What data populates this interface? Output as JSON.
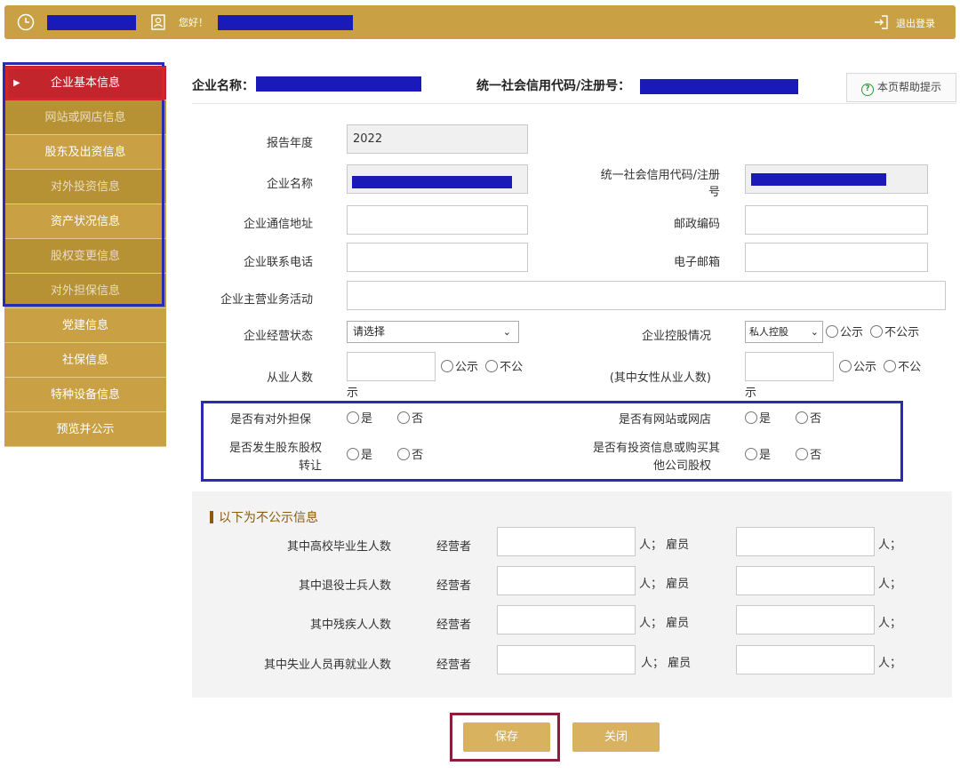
{
  "topbar": {
    "greeting": "您好！",
    "logout": "退出登录"
  },
  "sidebar": {
    "items": [
      {
        "label": "企业基本信息"
      },
      {
        "label": "网站或网店信息"
      },
      {
        "label": "股东及出资信息"
      },
      {
        "label": "对外投资信息"
      },
      {
        "label": "资产状况信息"
      },
      {
        "label": "股权变更信息"
      },
      {
        "label": "对外担保信息"
      },
      {
        "label": "党建信息"
      },
      {
        "label": "社保信息"
      },
      {
        "label": "特种设备信息"
      },
      {
        "label": "预览并公示"
      }
    ]
  },
  "header": {
    "company_label": "企业名称：",
    "credit_label": "统一社会信用代码/注册号：",
    "help": "本页帮助提示"
  },
  "form": {
    "report_year_label": "报告年度",
    "report_year_value": "2022",
    "company_name_label": "企业名称",
    "credit_code_label_1": "统一社会信用代码/注册",
    "credit_code_label_2": "号",
    "address_label": "企业通信地址",
    "postal_label": "邮政编码",
    "phone_label": "企业联系电话",
    "email_label": "电子邮箱",
    "business_label": "企业主营业务活动",
    "status_label": "企业经营状态",
    "status_value": "请选择",
    "holding_label": "企业控股情况",
    "holding_value": "私人控股",
    "employees_label": "从业人数",
    "female_label": "(其中女性从业人数)",
    "public": "公示",
    "not_public_short": "不公",
    "not_public_tail": "示",
    "not_public": "不公示",
    "guarantee_label": "是否有对外担保",
    "website_label": "是否有网站或网店",
    "equity_transfer_label_1": "是否发生股东股权",
    "equity_transfer_label_2": "转让",
    "investment_label_1": "是否有投资信息或购买其",
    "investment_label_2": "他公司股权",
    "yes": "是",
    "no": "否"
  },
  "nonpublic": {
    "title": "以下为不公示信息",
    "operator": "经营者",
    "person_employee": "人；  雇员",
    "person_end": "人；",
    "rows": [
      {
        "label": "其中高校毕业生人数"
      },
      {
        "label": "其中退役士兵人数"
      },
      {
        "label": "其中残疾人人数"
      },
      {
        "label": "其中失业人员再就业人数"
      }
    ]
  },
  "buttons": {
    "save": "保存",
    "close": "关闭"
  },
  "colors": {
    "gold": "#c9a043",
    "active_red": "#c2262c",
    "highlight_blue": "#2b2bb0",
    "redaction": "#1a1ab8"
  }
}
